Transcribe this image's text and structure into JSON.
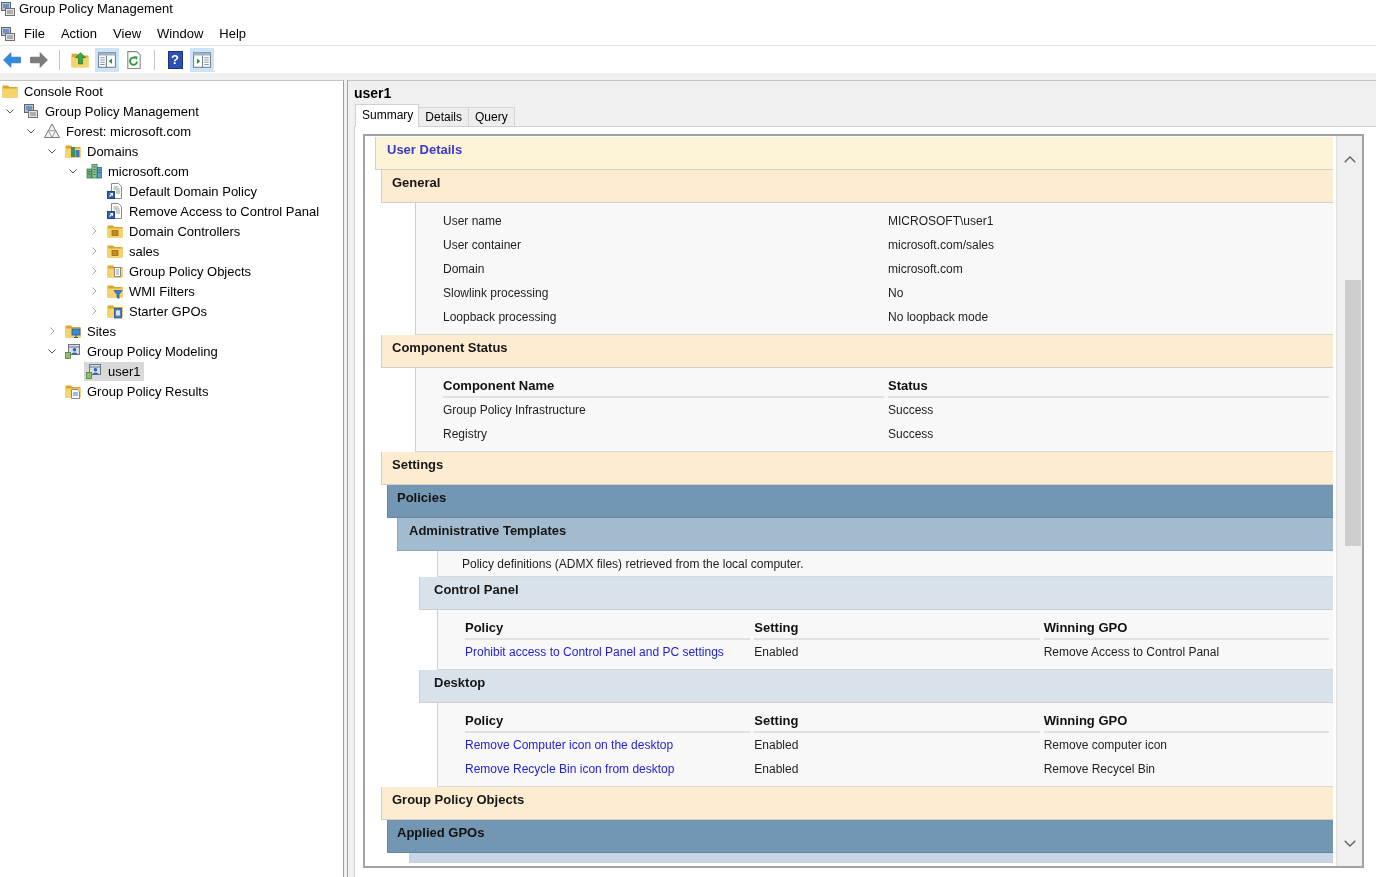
{
  "window": {
    "title": "Group Policy Management"
  },
  "menu_bar": {
    "items": [
      "File",
      "Action",
      "View",
      "Window",
      "Help"
    ]
  },
  "toolbar": {
    "groups": [
      {
        "buttons": [
          {
            "kind": "back",
            "on": false,
            "disabled": false
          },
          {
            "kind": "forward",
            "on": false,
            "disabled": true
          }
        ]
      },
      {
        "buttons": [
          {
            "kind": "up",
            "on": false,
            "disabled": false
          },
          {
            "kind": "console_tree",
            "on": true,
            "disabled": false
          },
          {
            "kind": "refresh",
            "on": false,
            "disabled": false
          }
        ]
      },
      {
        "buttons": [
          {
            "kind": "help",
            "label": "?",
            "on": false,
            "disabled": false
          },
          {
            "kind": "action_pane",
            "on": true,
            "disabled": false
          }
        ]
      }
    ]
  },
  "console_tree": {
    "items": [
      {
        "label": "Console Root",
        "kind": "root",
        "selected": false,
        "children": [
          {
            "label": "Group Policy Management",
            "kind": "snapin",
            "expanded": true,
            "selected": false,
            "children": [
              {
                "label": "Forest: microsoft.com",
                "kind": "forest",
                "expanded": true,
                "selected": false,
                "children": [
                  {
                    "label": "Domains",
                    "kind": "domains",
                    "expanded": true,
                    "selected": false,
                    "children": [
                      {
                        "label": "microsoft.com",
                        "kind": "domain",
                        "expanded": true,
                        "selected": false,
                        "children": [
                          {
                            "label": "Default Domain Policy",
                            "kind": "gpo_link",
                            "selected": false
                          },
                          {
                            "label": "Remove Access to Control Panal",
                            "kind": "gpo_link",
                            "selected": false
                          },
                          {
                            "label": "Domain Controllers",
                            "kind": "ou",
                            "expanded": false,
                            "selected": false
                          },
                          {
                            "label": "sales",
                            "kind": "ou",
                            "expanded": false,
                            "selected": false
                          },
                          {
                            "label": "Group Policy Objects",
                            "kind": "gpo_container",
                            "expanded": false,
                            "selected": false
                          },
                          {
                            "label": "WMI Filters",
                            "kind": "wmi_container",
                            "expanded": false,
                            "selected": false
                          },
                          {
                            "label": "Starter GPOs",
                            "kind": "starter_container",
                            "expanded": false,
                            "selected": false
                          }
                        ]
                      }
                    ]
                  },
                  {
                    "label": "Sites",
                    "kind": "sites",
                    "expanded": false,
                    "selected": false
                  },
                  {
                    "label": "Group Policy Modeling",
                    "kind": "modeling",
                    "expanded": true,
                    "selected": false,
                    "children": [
                      {
                        "label": "user1",
                        "kind": "query",
                        "selected": true
                      }
                    ]
                  },
                  {
                    "label": "Group Policy Results",
                    "kind": "results",
                    "selected": false
                  }
                ]
              }
            ]
          }
        ]
      }
    ]
  },
  "details_pane": {
    "title": "user1",
    "tabs": [
      {
        "label": "Summary",
        "selected": true
      },
      {
        "label": "Details",
        "selected": false
      },
      {
        "label": "Query",
        "selected": false
      }
    ],
    "report": {
      "sections": [
        {
          "title": "User Details",
          "kind": "report_header",
          "children": [
            {
              "title": "General",
              "kind": "group",
              "fields": [
                {
                  "label": "User name",
                  "value": "MICROSOFT\\user1"
                },
                {
                  "label": "User container",
                  "value": "microsoft.com/sales"
                },
                {
                  "label": "Domain",
                  "value": "microsoft.com"
                },
                {
                  "label": "Slowlink processing",
                  "value": "No"
                },
                {
                  "label": "Loopback processing",
                  "value": "No loopback mode"
                }
              ]
            },
            {
              "title": "Component Status",
              "kind": "group",
              "table": {
                "columns": [
                  {
                    "label": "Component Name",
                    "kind": "text"
                  },
                  {
                    "label": "Status",
                    "kind": "text"
                  }
                ],
                "rows": [
                  [
                    "Group Policy Infrastructure",
                    "Success"
                  ],
                  [
                    "Registry",
                    "Success"
                  ]
                ]
              }
            },
            {
              "title": "Settings",
              "kind": "group",
              "children": [
                {
                  "title": "Policies",
                  "kind": "category",
                  "children": [
                    {
                      "title": "Administrative Templates",
                      "kind": "extension",
                      "note": "Policy definitions (ADMX files) retrieved from the local computer.",
                      "children": [
                        {
                          "title": "Control Panel",
                          "kind": "policy_group",
                          "table": {
                            "columns": [
                              {
                                "label": "Policy",
                                "kind": "link"
                              },
                              {
                                "label": "Setting",
                                "kind": "text"
                              },
                              {
                                "label": "Winning GPO",
                                "kind": "text"
                              }
                            ],
                            "rows": [
                              [
                                "Prohibit access to Control Panel and PC settings",
                                "Enabled",
                                "Remove Access to Control Panal"
                              ]
                            ]
                          }
                        },
                        {
                          "title": "Desktop",
                          "kind": "policy_group",
                          "table": {
                            "columns": [
                              {
                                "label": "Policy",
                                "kind": "link"
                              },
                              {
                                "label": "Setting",
                                "kind": "text"
                              },
                              {
                                "label": "Winning GPO",
                                "kind": "text"
                              }
                            ],
                            "rows": [
                              [
                                "Remove Computer icon on the desktop",
                                "Enabled",
                                "Remove computer icon"
                              ],
                              [
                                "Remove Recycle Bin icon from desktop",
                                "Enabled",
                                "Remove Recycel Bin"
                              ]
                            ]
                          }
                        }
                      ]
                    }
                  ]
                }
              ]
            },
            {
              "title": "Group Policy Objects",
              "kind": "group",
              "children": [
                {
                  "title": "Applied GPOs",
                  "kind": "category",
                  "children": [
                    {
                      "kind": "gpo"
                    }
                  ]
                }
              ]
            }
          ]
        }
      ]
    }
  }
}
